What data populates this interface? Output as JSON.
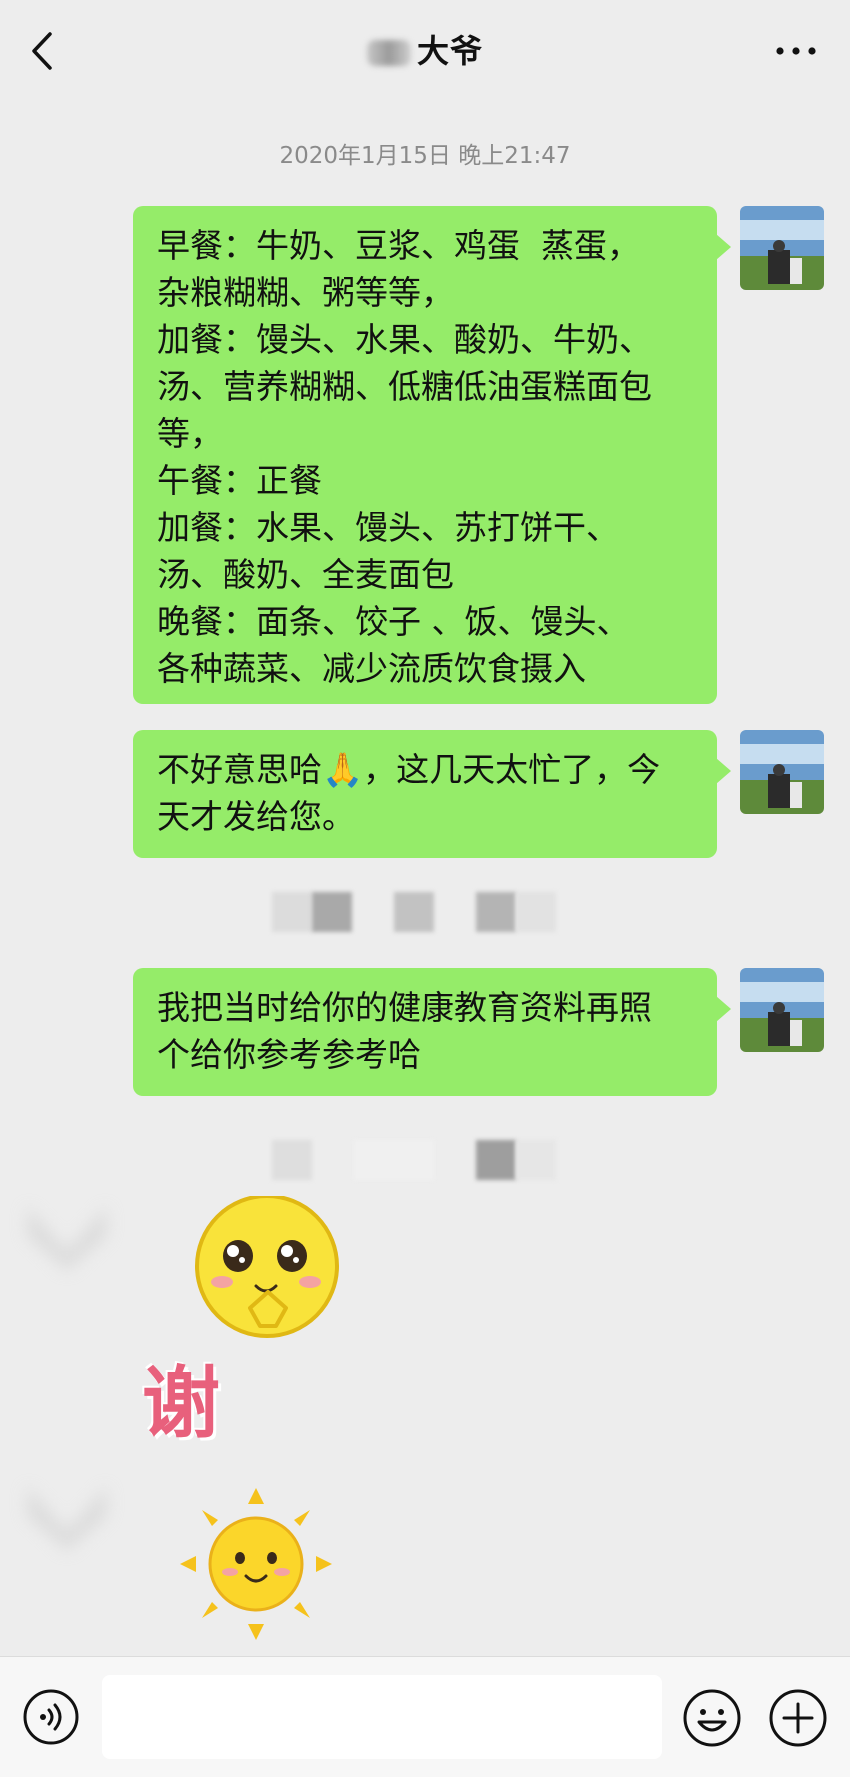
{
  "header": {
    "title": "大爷",
    "back_icon": "chevron-left-icon",
    "more_icon": "more-horizontal-icon"
  },
  "timestamp": "2020年1月15日 晚上21:47",
  "messages": [
    {
      "text": "早餐：牛奶、豆浆、鸡蛋  蒸蛋，\n杂粮糊糊、粥等等，\n加餐：馒头、水果、酸奶、牛奶、\n汤、营养糊糊、低糖低油蛋糕面包\n等，\n午餐：正餐\n加餐：水果、馒头、苏打饼干、\n汤、酸奶、全麦面包\n晚餐：面条、饺子 、饭、馒头、\n各种蔬菜、减少流质饮食摄入"
    },
    {
      "text_before": "不好意思哈",
      "emoji": "🙏",
      "text_after": "，这几天太忙了，今\n天才发给您。"
    },
    {
      "text": "我把当时给你的健康教育资料再照\n个给你参考参考哈"
    }
  ],
  "stickers": {
    "thanks_text": "谢",
    "thanks_icon": "smiley-thank-you-sticker",
    "sun_icon": "smiling-sun-sticker"
  },
  "colors": {
    "background": "#ededed",
    "bubble_green": "#95ec69",
    "timestamp_gray": "#8a8a8a",
    "thanks_pink": "#e8607c"
  },
  "input": {
    "placeholder": "",
    "value": ""
  }
}
